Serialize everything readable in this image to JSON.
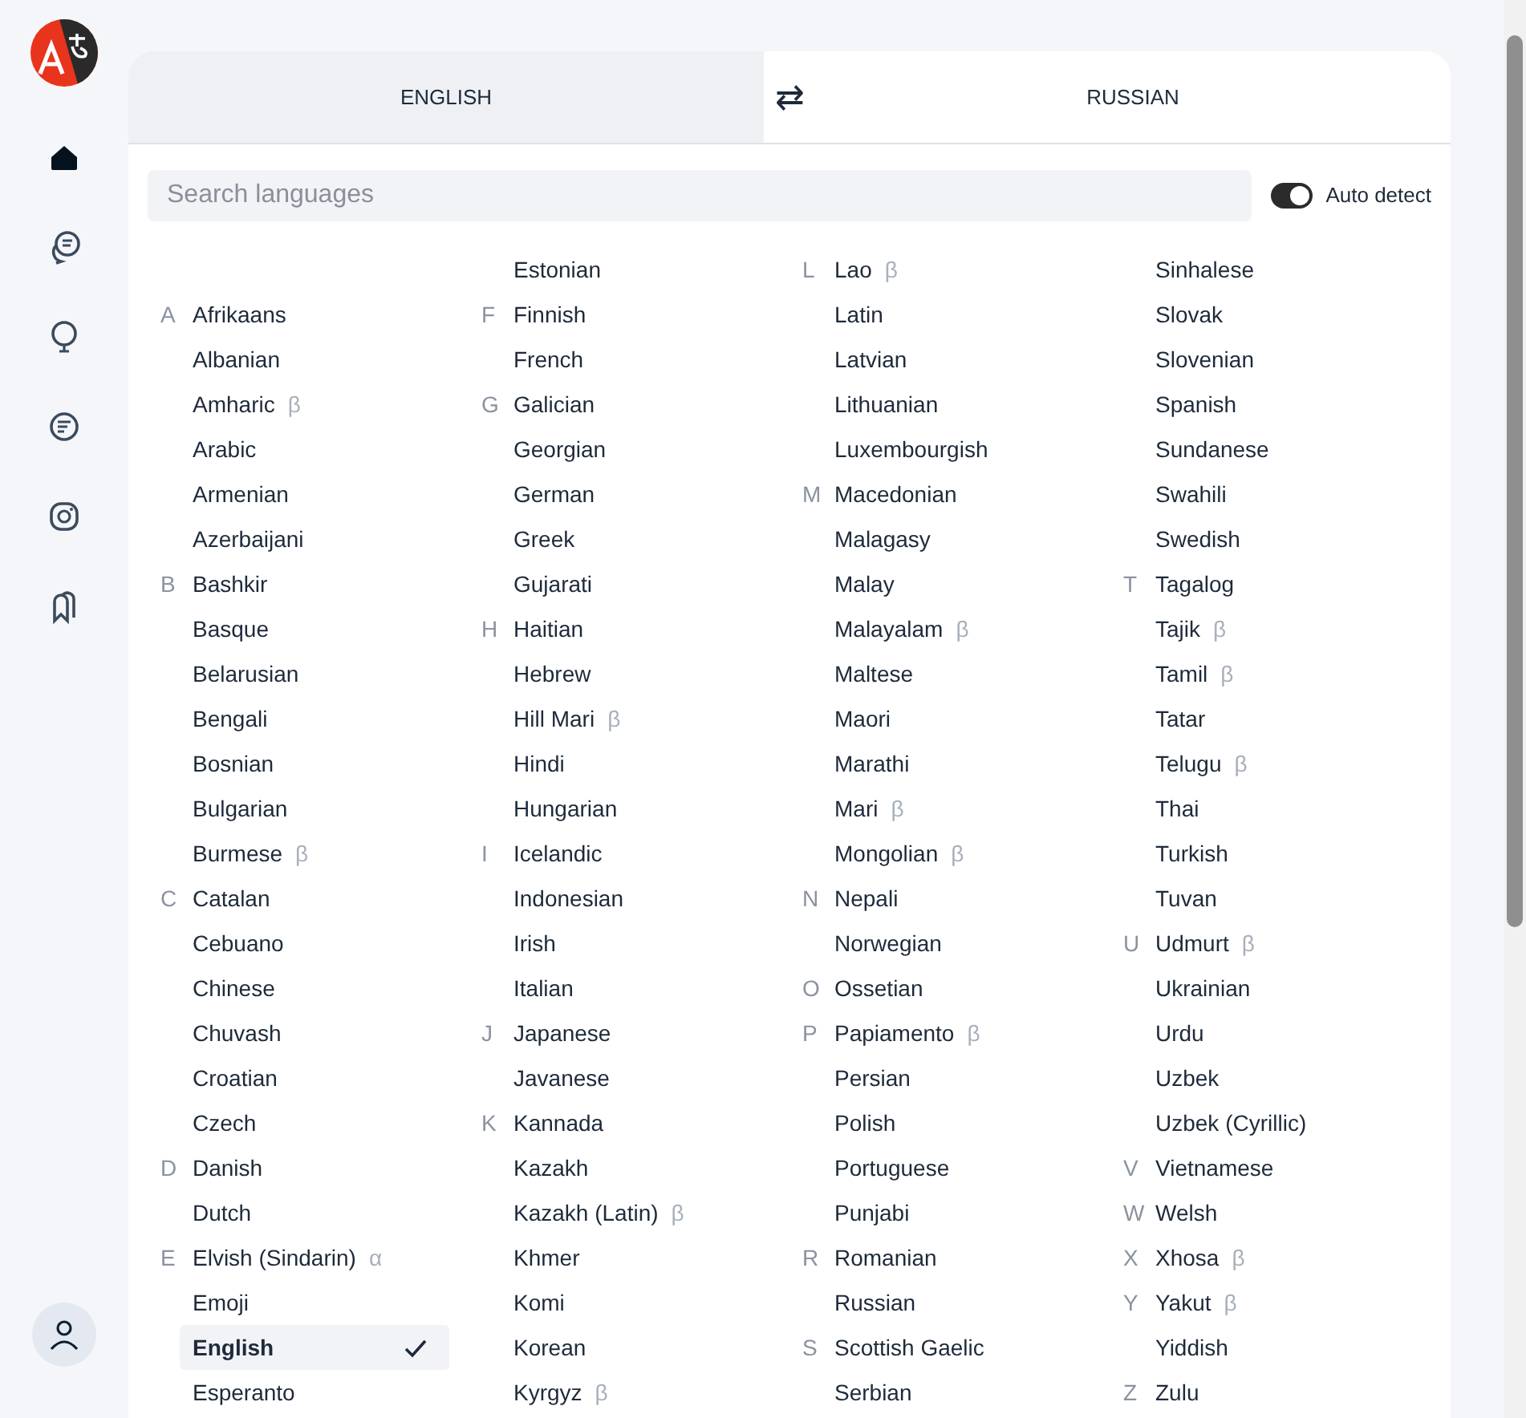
{
  "sidebar": {
    "items": [
      {
        "kind": "home",
        "selected": true
      },
      {
        "kind": "chat",
        "selected": false
      },
      {
        "kind": "bulb",
        "selected": false
      },
      {
        "kind": "text",
        "selected": false
      },
      {
        "kind": "camera",
        "selected": false
      },
      {
        "kind": "bookmark",
        "selected": false
      }
    ]
  },
  "tabs": [
    {
      "label": "ENGLISH",
      "selected": true
    },
    {
      "label": "RUSSIAN",
      "selected": false
    }
  ],
  "swap": "⇄",
  "search": {
    "placeholder": "Search languages"
  },
  "auto_detect": {
    "label": "Auto detect",
    "on": true
  },
  "columns": [
    [
      {
        "letter": "A",
        "name": "Afrikaans",
        "selected": false
      },
      {
        "name": "Albanian",
        "selected": false
      },
      {
        "name": "Amharic",
        "tag": "β",
        "selected": false
      },
      {
        "name": "Arabic",
        "selected": false
      },
      {
        "name": "Armenian",
        "selected": false
      },
      {
        "name": "Azerbaijani",
        "selected": false
      },
      {
        "letter": "B",
        "name": "Bashkir",
        "selected": false
      },
      {
        "name": "Basque",
        "selected": false
      },
      {
        "name": "Belarusian",
        "selected": false
      },
      {
        "name": "Bengali",
        "selected": false
      },
      {
        "name": "Bosnian",
        "selected": false
      },
      {
        "name": "Bulgarian",
        "selected": false
      },
      {
        "name": "Burmese",
        "tag": "β",
        "selected": false
      },
      {
        "letter": "C",
        "name": "Catalan",
        "selected": false
      },
      {
        "name": "Cebuano",
        "selected": false
      },
      {
        "name": "Chinese",
        "selected": false
      },
      {
        "name": "Chuvash",
        "selected": false
      },
      {
        "name": "Croatian",
        "selected": false
      },
      {
        "name": "Czech",
        "selected": false
      },
      {
        "letter": "D",
        "name": "Danish",
        "selected": false
      },
      {
        "name": "Dutch",
        "selected": false
      },
      {
        "letter": "E",
        "name": "Elvish (Sindarin)",
        "tag": "α",
        "selected": false
      },
      {
        "name": "Emoji",
        "selected": false
      },
      {
        "name": "English",
        "selected": true
      },
      {
        "name": "Esperanto",
        "selected": false
      }
    ],
    [
      {
        "name": "Estonian",
        "selected": false
      },
      {
        "letter": "F",
        "name": "Finnish",
        "selected": false
      },
      {
        "name": "French",
        "selected": false
      },
      {
        "letter": "G",
        "name": "Galician",
        "selected": false
      },
      {
        "name": "Georgian",
        "selected": false
      },
      {
        "name": "German",
        "selected": false
      },
      {
        "name": "Greek",
        "selected": false
      },
      {
        "name": "Gujarati",
        "selected": false
      },
      {
        "letter": "H",
        "name": "Haitian",
        "selected": false
      },
      {
        "name": "Hebrew",
        "selected": false
      },
      {
        "name": "Hill Mari",
        "tag": "β",
        "selected": false
      },
      {
        "name": "Hindi",
        "selected": false
      },
      {
        "name": "Hungarian",
        "selected": false
      },
      {
        "letter": "I",
        "name": "Icelandic",
        "selected": false
      },
      {
        "name": "Indonesian",
        "selected": false
      },
      {
        "name": "Irish",
        "selected": false
      },
      {
        "name": "Italian",
        "selected": false
      },
      {
        "letter": "J",
        "name": "Japanese",
        "selected": false
      },
      {
        "name": "Javanese",
        "selected": false
      },
      {
        "letter": "K",
        "name": "Kannada",
        "selected": false
      },
      {
        "name": "Kazakh",
        "selected": false
      },
      {
        "name": "Kazakh (Latin)",
        "tag": "β",
        "selected": false
      },
      {
        "name": "Khmer",
        "selected": false
      },
      {
        "name": "Komi",
        "selected": false
      },
      {
        "name": "Korean",
        "selected": false
      },
      {
        "name": "Kyrgyz",
        "tag": "β",
        "selected": false
      }
    ],
    [
      {
        "letter": "L",
        "name": "Lao",
        "tag": "β",
        "selected": false
      },
      {
        "name": "Latin",
        "selected": false
      },
      {
        "name": "Latvian",
        "selected": false
      },
      {
        "name": "Lithuanian",
        "selected": false
      },
      {
        "name": "Luxembourgish",
        "selected": false
      },
      {
        "letter": "M",
        "name": "Macedonian",
        "selected": false
      },
      {
        "name": "Malagasy",
        "selected": false
      },
      {
        "name": "Malay",
        "selected": false
      },
      {
        "name": "Malayalam",
        "tag": "β",
        "selected": false
      },
      {
        "name": "Maltese",
        "selected": false
      },
      {
        "name": "Maori",
        "selected": false
      },
      {
        "name": "Marathi",
        "selected": false
      },
      {
        "name": "Mari",
        "tag": "β",
        "selected": false
      },
      {
        "name": "Mongolian",
        "tag": "β",
        "selected": false
      },
      {
        "letter": "N",
        "name": "Nepali",
        "selected": false
      },
      {
        "name": "Norwegian",
        "selected": false
      },
      {
        "letter": "O",
        "name": "Ossetian",
        "selected": false
      },
      {
        "letter": "P",
        "name": "Papiamento",
        "tag": "β",
        "selected": false
      },
      {
        "name": "Persian",
        "selected": false
      },
      {
        "name": "Polish",
        "selected": false
      },
      {
        "name": "Portuguese",
        "selected": false
      },
      {
        "name": "Punjabi",
        "selected": false
      },
      {
        "letter": "R",
        "name": "Romanian",
        "selected": false
      },
      {
        "name": "Russian",
        "selected": false
      },
      {
        "letter": "S",
        "name": "Scottish Gaelic",
        "selected": false
      },
      {
        "name": "Serbian",
        "selected": false
      }
    ],
    [
      {
        "name": "Sinhalese",
        "selected": false
      },
      {
        "name": "Slovak",
        "selected": false
      },
      {
        "name": "Slovenian",
        "selected": false
      },
      {
        "name": "Spanish",
        "selected": false
      },
      {
        "name": "Sundanese",
        "selected": false
      },
      {
        "name": "Swahili",
        "selected": false
      },
      {
        "name": "Swedish",
        "selected": false
      },
      {
        "letter": "T",
        "name": "Tagalog",
        "selected": false
      },
      {
        "name": "Tajik",
        "tag": "β",
        "selected": false
      },
      {
        "name": "Tamil",
        "tag": "β",
        "selected": false
      },
      {
        "name": "Tatar",
        "selected": false
      },
      {
        "name": "Telugu",
        "tag": "β",
        "selected": false
      },
      {
        "name": "Thai",
        "selected": false
      },
      {
        "name": "Turkish",
        "selected": false
      },
      {
        "name": "Tuvan",
        "selected": false
      },
      {
        "letter": "U",
        "name": "Udmurt",
        "tag": "β",
        "selected": false
      },
      {
        "name": "Ukrainian",
        "selected": false
      },
      {
        "name": "Urdu",
        "selected": false
      },
      {
        "name": "Uzbek",
        "selected": false
      },
      {
        "name": "Uzbek (Cyrillic)",
        "selected": false
      },
      {
        "letter": "V",
        "name": "Vietnamese",
        "selected": false
      },
      {
        "letter": "W",
        "name": "Welsh",
        "selected": false
      },
      {
        "letter": "X",
        "name": "Xhosa",
        "tag": "β",
        "selected": false
      },
      {
        "letter": "Y",
        "name": "Yakut",
        "tag": "β",
        "selected": false
      },
      {
        "name": "Yiddish",
        "selected": false
      },
      {
        "letter": "Z",
        "name": "Zulu",
        "selected": false
      }
    ]
  ]
}
